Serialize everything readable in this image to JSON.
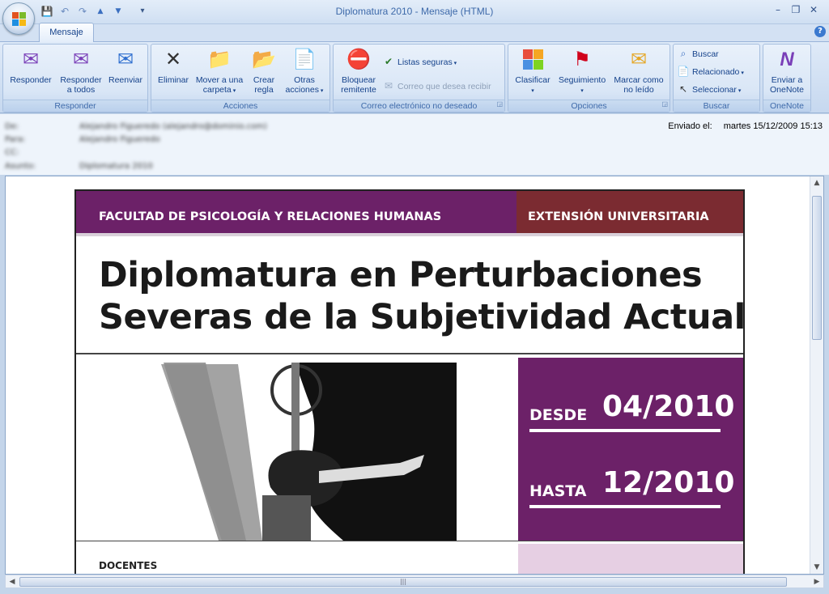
{
  "window": {
    "title": "Diplomatura 2010 - Mensaje (HTML)",
    "controls": {
      "minimize": "–",
      "restore": "❐",
      "close": "✕"
    }
  },
  "qat": {
    "save_icon": "💾",
    "undo_icon": "↶",
    "redo_icon": "↷",
    "prev_icon": "▲",
    "next_icon": "▼",
    "customize_icon": "▾"
  },
  "tabs": [
    {
      "label": "Mensaje",
      "active": true
    }
  ],
  "help": "?",
  "ribbon": {
    "responder": {
      "title": "Responder",
      "reply": "Responder",
      "reply_all_l1": "Responder",
      "reply_all_l2": "a todos",
      "forward": "Reenviar"
    },
    "acciones": {
      "title": "Acciones",
      "delete": "Eliminar",
      "move_l1": "Mover a una",
      "move_l2": "carpeta",
      "rule_l1": "Crear",
      "rule_l2": "regla",
      "other_l1": "Otras",
      "other_l2": "acciones"
    },
    "junk": {
      "title": "Correo electrónico no deseado",
      "block_l1": "Bloquear",
      "block_l2": "remitente",
      "safe_lists": "Listas seguras",
      "not_junk": "Correo que desea recibir"
    },
    "opciones": {
      "title": "Opciones",
      "categorize": "Clasificar",
      "follow_up": "Seguimiento",
      "mark_unread_l1": "Marcar como",
      "mark_unread_l2": "no leído"
    },
    "buscar": {
      "title": "Buscar",
      "find": "Buscar",
      "related": "Relacionado",
      "select": "Seleccionar"
    },
    "onenote": {
      "title": "OneNote",
      "send_l1": "Enviar a",
      "send_l2": "OneNote"
    }
  },
  "header": {
    "from_label": "De:",
    "from_value": "Alejandro Figueredo (alejandro@dominio.com)",
    "to_label": "Para:",
    "to_value": "Alejandro Figueredo",
    "cc_label": "CC:",
    "cc_value": "",
    "subject_label": "Asunto:",
    "subject_value": "Diplomatura 2010",
    "sent_label": "Enviado el:",
    "sent_value": "martes 15/12/2009 15:13"
  },
  "flyer": {
    "faculty": "FACULTAD DE PSICOLOGÍA Y RELACIONES HUMANAS",
    "extension": "EXTENSIÓN UNIVERSITARIA",
    "title_l1": "Diplomatura en Perturbaciones",
    "title_l2": "Severas de la Subjetividad Actual",
    "desde_label": "DESDE",
    "desde_value": "04/2010",
    "hasta_label": "HASTA",
    "hasta_value": "12/2010",
    "docentes": "DOCENTES",
    "colors": {
      "purple": "#6c2168",
      "maroon": "#7b2b31",
      "pink": "#e6cfe3"
    }
  }
}
